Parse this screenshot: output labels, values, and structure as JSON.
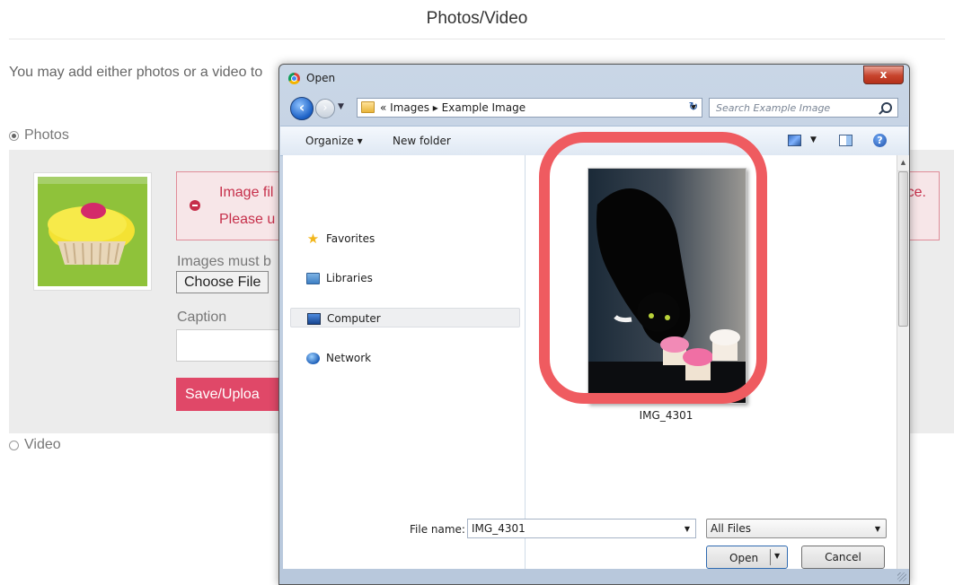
{
  "page": {
    "title": "Photos/Video",
    "intro": "You may add either photos or a video to",
    "photos_label": "Photos",
    "video_label": "Video",
    "error_line1": "Image fil",
    "error_line2": "Please u",
    "error_tail": "ce.",
    "image_rule": "Images must b",
    "choose_file_label": "Choose File",
    "caption_label": "Caption",
    "caption_value": "",
    "save_label": "Save/Uploa"
  },
  "dialog": {
    "title": "Open",
    "close_label": "x",
    "breadcrumb": "« Images ▸ Example Image",
    "search_placeholder": "Search Example Image",
    "toolbar": {
      "organize_label": "Organize ▾",
      "new_folder_label": "New folder",
      "help_label": "?"
    },
    "nav_items": [
      {
        "label": "Favorites",
        "icon": "star-icon"
      },
      {
        "label": "Libraries",
        "icon": "libraries-icon"
      },
      {
        "label": "Computer",
        "icon": "computer-icon",
        "selected": true
      },
      {
        "label": "Network",
        "icon": "network-icon"
      }
    ],
    "file": {
      "name": "IMG_4301"
    },
    "file_name_label": "File name:",
    "file_name_value": "IMG_4301",
    "file_type_value": "All Files",
    "open_label": "Open",
    "cancel_label": "Cancel"
  },
  "colors": {
    "accent_button": "#e04868",
    "error_text": "#c62f4a",
    "highlight_ring": "#ef5b60"
  }
}
